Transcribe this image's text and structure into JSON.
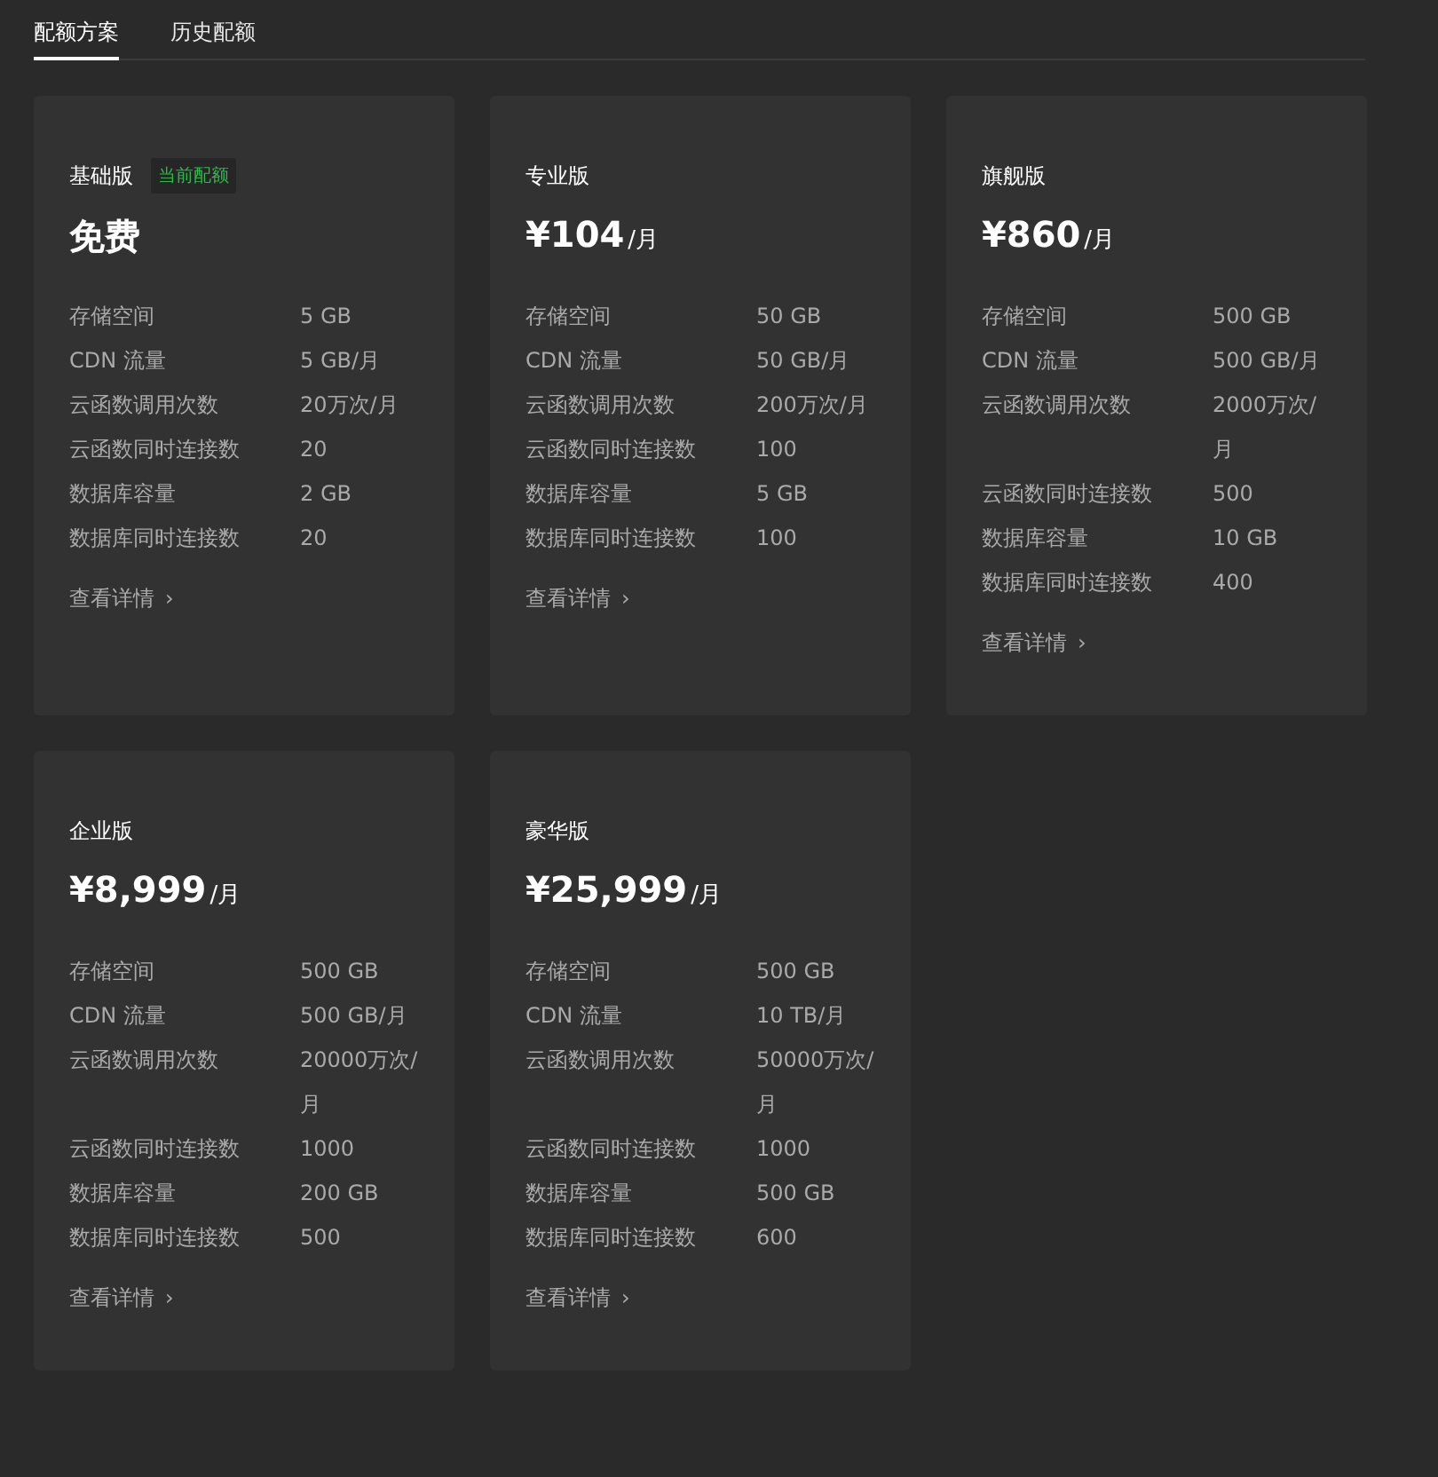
{
  "tabs": [
    {
      "label": "配额方案",
      "selected": true
    },
    {
      "label": "历史配额",
      "selected": false
    }
  ],
  "plans": [
    {
      "name": "基础版",
      "badge": "当前配额",
      "price": "免费",
      "specs": [
        {
          "label": "存储空间",
          "value": "5 GB"
        },
        {
          "label": "CDN 流量",
          "value": "5 GB/月"
        },
        {
          "label": "云函数调用次数",
          "value": "20万次/月"
        },
        {
          "label": "云函数同时连接数",
          "value": "20"
        },
        {
          "label": "数据库容量",
          "value": "2 GB"
        },
        {
          "label": "数据库同时连接数",
          "value": "20"
        }
      ],
      "link": "查看详情",
      "arrow": "›"
    },
    {
      "name": "专业版",
      "price": "¥104",
      "unit": "/月",
      "specs": [
        {
          "label": "存储空间",
          "value": "50 GB"
        },
        {
          "label": "CDN 流量",
          "value": "50 GB/月"
        },
        {
          "label": "云函数调用次数",
          "value": "200万次/月"
        },
        {
          "label": "云函数同时连接数",
          "value": "100"
        },
        {
          "label": "数据库容量",
          "value": "5 GB"
        },
        {
          "label": "数据库同时连接数",
          "value": "100"
        }
      ],
      "link": "查看详情",
      "arrow": "›"
    },
    {
      "name": "旗舰版",
      "price": "¥860",
      "unit": "/月",
      "specs": [
        {
          "label": "存储空间",
          "value": "500 GB"
        },
        {
          "label": "CDN 流量",
          "value": "500 GB/月"
        },
        {
          "label": "云函数调用次数",
          "value": "2000万次/月"
        },
        {
          "label": "云函数同时连接数",
          "value": "500"
        },
        {
          "label": "数据库容量",
          "value": "10 GB"
        },
        {
          "label": "数据库同时连接数",
          "value": "400"
        }
      ],
      "link": "查看详情",
      "arrow": "›"
    },
    {
      "name": "企业版",
      "price": "¥8,999",
      "unit": "/月",
      "specs": [
        {
          "label": "存储空间",
          "value": "500 GB"
        },
        {
          "label": "CDN 流量",
          "value": "500 GB/月"
        },
        {
          "label": "云函数调用次数",
          "value": "20000万次/月"
        },
        {
          "label": "云函数同时连接数",
          "value": "1000"
        },
        {
          "label": "数据库容量",
          "value": "200 GB"
        },
        {
          "label": "数据库同时连接数",
          "value": "500"
        }
      ],
      "link": "查看详情",
      "arrow": "›"
    },
    {
      "name": "豪华版",
      "price": "¥25,999",
      "unit": "/月",
      "specs": [
        {
          "label": "存储空间",
          "value": "500 GB"
        },
        {
          "label": "CDN 流量",
          "value": "10 TB/月"
        },
        {
          "label": "云函数调用次数",
          "value": "50000万次/月"
        },
        {
          "label": "云函数同时连接数",
          "value": "1000"
        },
        {
          "label": "数据库容量",
          "value": "500 GB"
        },
        {
          "label": "数据库同时连接数",
          "value": "600"
        }
      ],
      "link": "查看详情",
      "arrow": "›"
    }
  ]
}
